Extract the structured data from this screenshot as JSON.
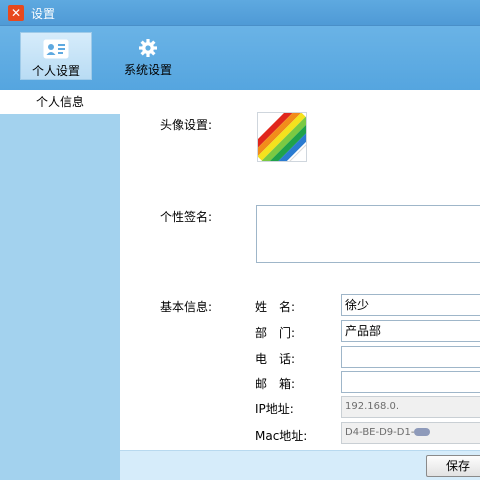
{
  "window": {
    "title": "设置",
    "app_icon": "app-logo-icon"
  },
  "toolbar": {
    "personal_label": "个人设置",
    "personal_icon": "contact-card-icon",
    "system_label": "系统设置",
    "system_icon": "gear-icon"
  },
  "sidebar": {
    "items": [
      {
        "label": "个人信息",
        "selected": true
      }
    ]
  },
  "form": {
    "avatar_label": "头像设置:",
    "signature_label": "个性签名:",
    "signature_value": "",
    "basic_info_label": "基本信息:",
    "name_label": "姓　名:",
    "name_value": "徐少",
    "dept_label": "部　门:",
    "dept_value": "产品部",
    "phone_label": "电　话:",
    "phone_value": "",
    "email_label": "邮　箱:",
    "email_value": "",
    "ip_label": "IP地址:",
    "ip_value": "192.168.0.",
    "mac_label": "Mac地址:",
    "mac_value": "D4-BE-D9-D1-"
  },
  "footer": {
    "save_label": "保存"
  },
  "colors": {
    "titlebar": "#5ea9e0",
    "toolbar": "#6ab3e6",
    "sidebar": "#a3d2ee",
    "bottombar": "#d6ecfa"
  }
}
